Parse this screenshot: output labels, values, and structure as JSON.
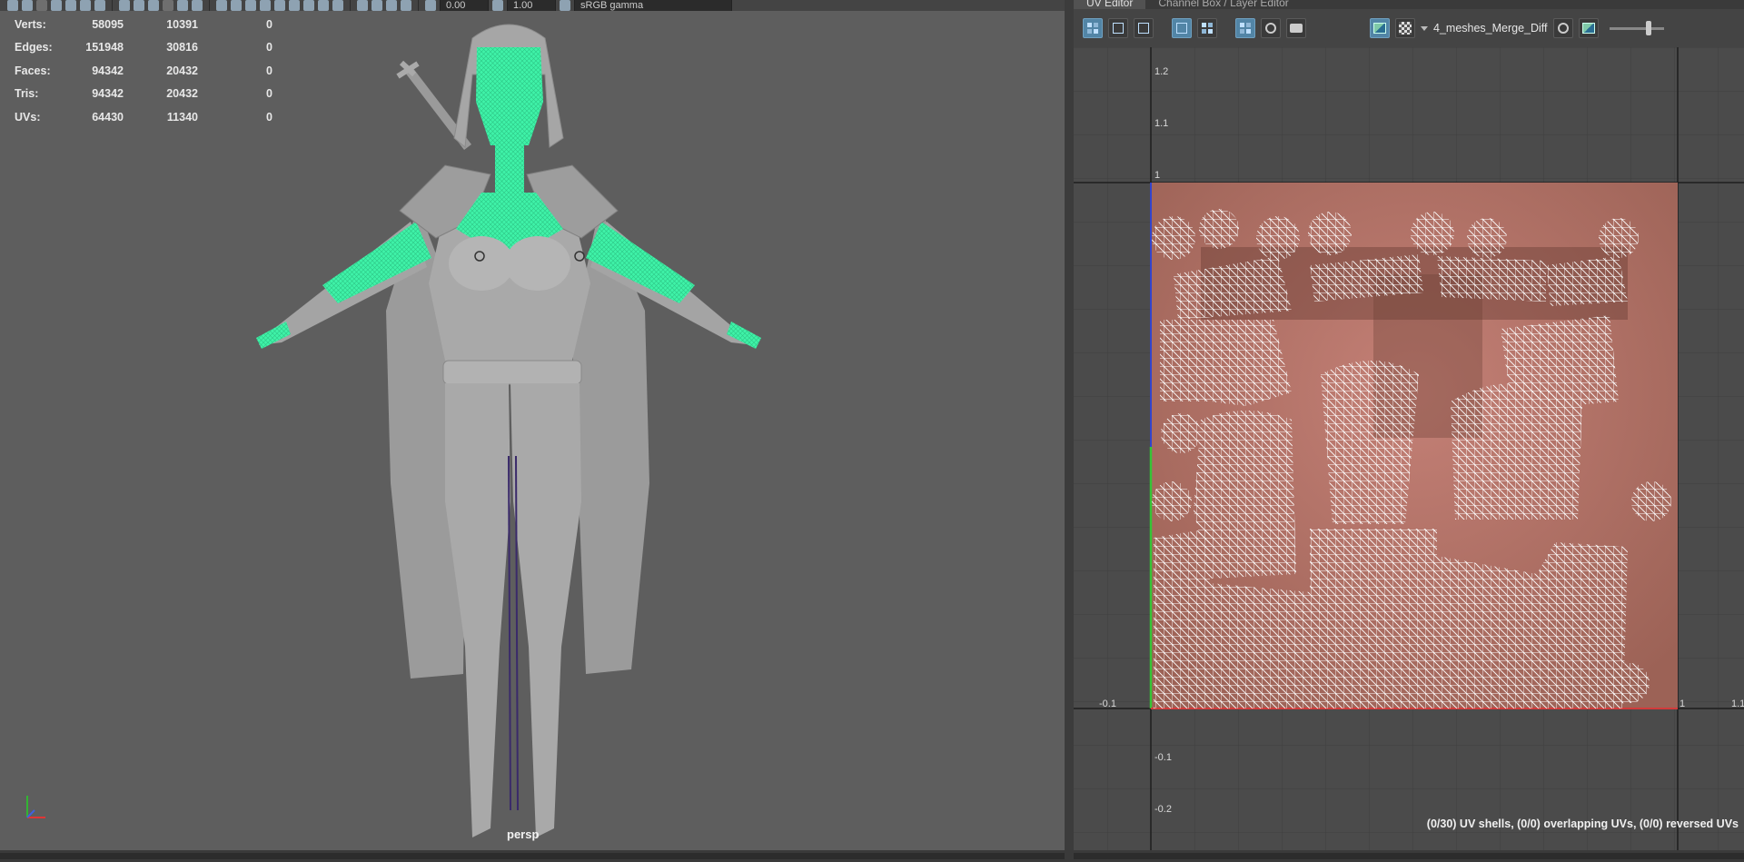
{
  "viewport": {
    "toolbar": {
      "field_1": "0.00",
      "field_2": "1.00",
      "colorspace": "sRGB gamma"
    },
    "hud": {
      "rows": [
        {
          "label": "Verts:",
          "v1": "58095",
          "v2": "10391",
          "v3": "0"
        },
        {
          "label": "Edges:",
          "v1": "151948",
          "v2": "30816",
          "v3": "0"
        },
        {
          "label": "Faces:",
          "v1": "94342",
          "v2": "20432",
          "v3": "0"
        },
        {
          "label": "Tris:",
          "v1": "94342",
          "v2": "20432",
          "v3": "0"
        },
        {
          "label": "UVs:",
          "v1": "64430",
          "v2": "11340",
          "v3": "0"
        }
      ]
    },
    "camera_label": "persp",
    "colors": {
      "selection": "#3ff2a8",
      "model": "#a9a9a9",
      "background": "#5e5e5e"
    }
  },
  "uv_editor": {
    "tabs": [
      {
        "label": "UV Editor",
        "active": true
      },
      {
        "label": "Channel Box / Layer Editor",
        "active": false
      }
    ],
    "texture_name": "4_meshes_Merge_Diff",
    "axis_labels": {
      "v_ticks": [
        "1.2",
        "1.1",
        "1",
        "-0.1",
        "-0.2"
      ],
      "u_ticks": [
        "-0.1",
        "1",
        "1.1"
      ]
    },
    "status": "(0/30) UV shells, (0/0) overlapping UVs, (0/0) reversed UVs",
    "colors": {
      "texture": "#b7776e",
      "wire": "#ffffff",
      "grid": "#3d3d3d",
      "u_axis": "#d23b3b",
      "v_axis": "#36c436"
    }
  }
}
